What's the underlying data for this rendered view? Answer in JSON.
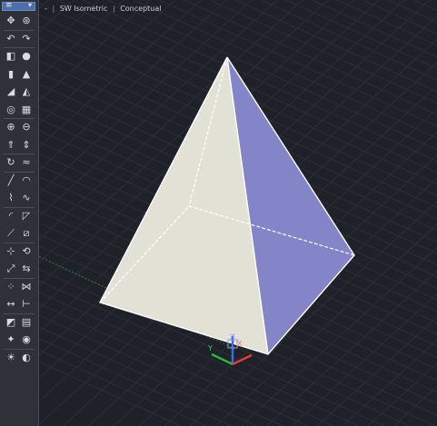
{
  "viewport": {
    "minus_label": "-",
    "view_label": "SW Isometric",
    "visual_style_label": "Conceptual"
  },
  "ucs_icon": {
    "x_label": "X",
    "y_label": "Y",
    "z_label": "Z"
  },
  "colors": {
    "background": "#1e2128",
    "grid": "#2a2e36",
    "face_light": "#e2e1d6",
    "face_blue": "#8484c8",
    "edge": "#ffffff",
    "axis_x": "#e23b3b",
    "axis_y": "#2fb33a",
    "axis_z": "#3b6be2"
  },
  "palette": {
    "header_glyph": "≡",
    "header_arrow": "▾",
    "tools": [
      {
        "name": "pan-icon",
        "glyph": "✥"
      },
      {
        "name": "orbit-icon",
        "glyph": "⊛"
      },
      {
        "name": "undo-icon",
        "glyph": "↶"
      },
      {
        "name": "redo-icon",
        "glyph": "↷"
      },
      {
        "name": "box-icon",
        "glyph": "◧"
      },
      {
        "name": "sphere-icon",
        "glyph": "●"
      },
      {
        "name": "cylinder-icon",
        "glyph": "▮"
      },
      {
        "name": "cone-icon",
        "glyph": "▲"
      },
      {
        "name": "wedge-icon",
        "glyph": "◢"
      },
      {
        "name": "pyramid-icon",
        "glyph": "◭"
      },
      {
        "name": "torus-icon",
        "glyph": "◎"
      },
      {
        "name": "polysolid-icon",
        "glyph": "▦"
      },
      {
        "name": "union-icon",
        "glyph": "⊕"
      },
      {
        "name": "subtract-icon",
        "glyph": "⊖"
      },
      {
        "name": "extrude-icon",
        "glyph": "⇑"
      },
      {
        "name": "presspull-icon",
        "glyph": "⇕"
      },
      {
        "name": "revolve-icon",
        "glyph": "↻"
      },
      {
        "name": "sweep-icon",
        "glyph": "≈"
      },
      {
        "name": "line-icon",
        "glyph": "╱"
      },
      {
        "name": "arc-icon",
        "glyph": "◠"
      },
      {
        "name": "polyline-icon",
        "glyph": "⌇"
      },
      {
        "name": "spline-icon",
        "glyph": "∿"
      },
      {
        "name": "fillet-icon",
        "glyph": "◜"
      },
      {
        "name": "chamfer-icon",
        "glyph": "◸"
      },
      {
        "name": "slice-icon",
        "glyph": "⟋"
      },
      {
        "name": "section-icon",
        "glyph": "⧄"
      },
      {
        "name": "move-icon",
        "glyph": "⊹"
      },
      {
        "name": "rotate-icon",
        "glyph": "⟲"
      },
      {
        "name": "scale-icon",
        "glyph": "⤢"
      },
      {
        "name": "mirror-icon",
        "glyph": "⇆"
      },
      {
        "name": "array-icon",
        "glyph": "⁘"
      },
      {
        "name": "align-icon",
        "glyph": "⋈"
      },
      {
        "name": "measure-icon",
        "glyph": "↔"
      },
      {
        "name": "dimension-icon",
        "glyph": "⊢"
      },
      {
        "name": "layer-icon",
        "glyph": "◩"
      },
      {
        "name": "properties-icon",
        "glyph": "▤"
      },
      {
        "name": "light-icon",
        "glyph": "✦"
      },
      {
        "name": "camera-icon",
        "glyph": "◉"
      },
      {
        "name": "render-icon",
        "glyph": "☀"
      },
      {
        "name": "material-icon",
        "glyph": "◐"
      }
    ]
  }
}
